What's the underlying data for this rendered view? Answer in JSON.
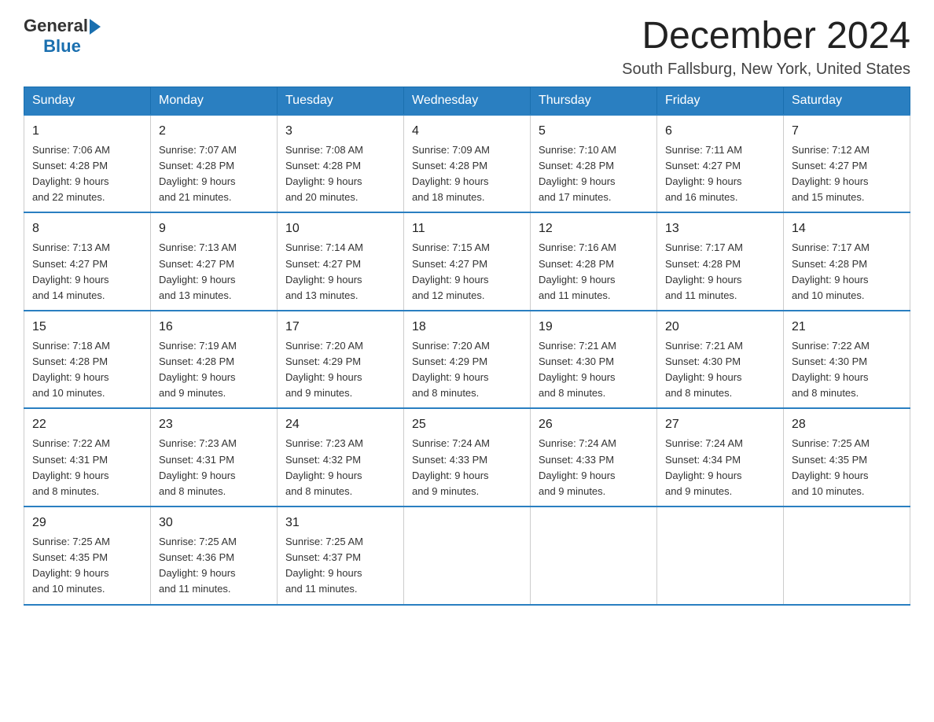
{
  "header": {
    "logo": {
      "text_general": "General",
      "text_blue": "Blue",
      "arrow": true
    },
    "month_title": "December 2024",
    "location": "South Fallsburg, New York, United States"
  },
  "days_of_week": [
    "Sunday",
    "Monday",
    "Tuesday",
    "Wednesday",
    "Thursday",
    "Friday",
    "Saturday"
  ],
  "weeks": [
    [
      {
        "day": "1",
        "sunrise": "7:06 AM",
        "sunset": "4:28 PM",
        "daylight": "9 hours and 22 minutes."
      },
      {
        "day": "2",
        "sunrise": "7:07 AM",
        "sunset": "4:28 PM",
        "daylight": "9 hours and 21 minutes."
      },
      {
        "day": "3",
        "sunrise": "7:08 AM",
        "sunset": "4:28 PM",
        "daylight": "9 hours and 20 minutes."
      },
      {
        "day": "4",
        "sunrise": "7:09 AM",
        "sunset": "4:28 PM",
        "daylight": "9 hours and 18 minutes."
      },
      {
        "day": "5",
        "sunrise": "7:10 AM",
        "sunset": "4:28 PM",
        "daylight": "9 hours and 17 minutes."
      },
      {
        "day": "6",
        "sunrise": "7:11 AM",
        "sunset": "4:27 PM",
        "daylight": "9 hours and 16 minutes."
      },
      {
        "day": "7",
        "sunrise": "7:12 AM",
        "sunset": "4:27 PM",
        "daylight": "9 hours and 15 minutes."
      }
    ],
    [
      {
        "day": "8",
        "sunrise": "7:13 AM",
        "sunset": "4:27 PM",
        "daylight": "9 hours and 14 minutes."
      },
      {
        "day": "9",
        "sunrise": "7:13 AM",
        "sunset": "4:27 PM",
        "daylight": "9 hours and 13 minutes."
      },
      {
        "day": "10",
        "sunrise": "7:14 AM",
        "sunset": "4:27 PM",
        "daylight": "9 hours and 13 minutes."
      },
      {
        "day": "11",
        "sunrise": "7:15 AM",
        "sunset": "4:27 PM",
        "daylight": "9 hours and 12 minutes."
      },
      {
        "day": "12",
        "sunrise": "7:16 AM",
        "sunset": "4:28 PM",
        "daylight": "9 hours and 11 minutes."
      },
      {
        "day": "13",
        "sunrise": "7:17 AM",
        "sunset": "4:28 PM",
        "daylight": "9 hours and 11 minutes."
      },
      {
        "day": "14",
        "sunrise": "7:17 AM",
        "sunset": "4:28 PM",
        "daylight": "9 hours and 10 minutes."
      }
    ],
    [
      {
        "day": "15",
        "sunrise": "7:18 AM",
        "sunset": "4:28 PM",
        "daylight": "9 hours and 10 minutes."
      },
      {
        "day": "16",
        "sunrise": "7:19 AM",
        "sunset": "4:28 PM",
        "daylight": "9 hours and 9 minutes."
      },
      {
        "day": "17",
        "sunrise": "7:20 AM",
        "sunset": "4:29 PM",
        "daylight": "9 hours and 9 minutes."
      },
      {
        "day": "18",
        "sunrise": "7:20 AM",
        "sunset": "4:29 PM",
        "daylight": "9 hours and 8 minutes."
      },
      {
        "day": "19",
        "sunrise": "7:21 AM",
        "sunset": "4:30 PM",
        "daylight": "9 hours and 8 minutes."
      },
      {
        "day": "20",
        "sunrise": "7:21 AM",
        "sunset": "4:30 PM",
        "daylight": "9 hours and 8 minutes."
      },
      {
        "day": "21",
        "sunrise": "7:22 AM",
        "sunset": "4:30 PM",
        "daylight": "9 hours and 8 minutes."
      }
    ],
    [
      {
        "day": "22",
        "sunrise": "7:22 AM",
        "sunset": "4:31 PM",
        "daylight": "9 hours and 8 minutes."
      },
      {
        "day": "23",
        "sunrise": "7:23 AM",
        "sunset": "4:31 PM",
        "daylight": "9 hours and 8 minutes."
      },
      {
        "day": "24",
        "sunrise": "7:23 AM",
        "sunset": "4:32 PM",
        "daylight": "9 hours and 8 minutes."
      },
      {
        "day": "25",
        "sunrise": "7:24 AM",
        "sunset": "4:33 PM",
        "daylight": "9 hours and 9 minutes."
      },
      {
        "day": "26",
        "sunrise": "7:24 AM",
        "sunset": "4:33 PM",
        "daylight": "9 hours and 9 minutes."
      },
      {
        "day": "27",
        "sunrise": "7:24 AM",
        "sunset": "4:34 PM",
        "daylight": "9 hours and 9 minutes."
      },
      {
        "day": "28",
        "sunrise": "7:25 AM",
        "sunset": "4:35 PM",
        "daylight": "9 hours and 10 minutes."
      }
    ],
    [
      {
        "day": "29",
        "sunrise": "7:25 AM",
        "sunset": "4:35 PM",
        "daylight": "9 hours and 10 minutes."
      },
      {
        "day": "30",
        "sunrise": "7:25 AM",
        "sunset": "4:36 PM",
        "daylight": "9 hours and 11 minutes."
      },
      {
        "day": "31",
        "sunrise": "7:25 AM",
        "sunset": "4:37 PM",
        "daylight": "9 hours and 11 minutes."
      },
      null,
      null,
      null,
      null
    ]
  ],
  "labels": {
    "sunrise": "Sunrise:",
    "sunset": "Sunset:",
    "daylight": "Daylight:"
  }
}
